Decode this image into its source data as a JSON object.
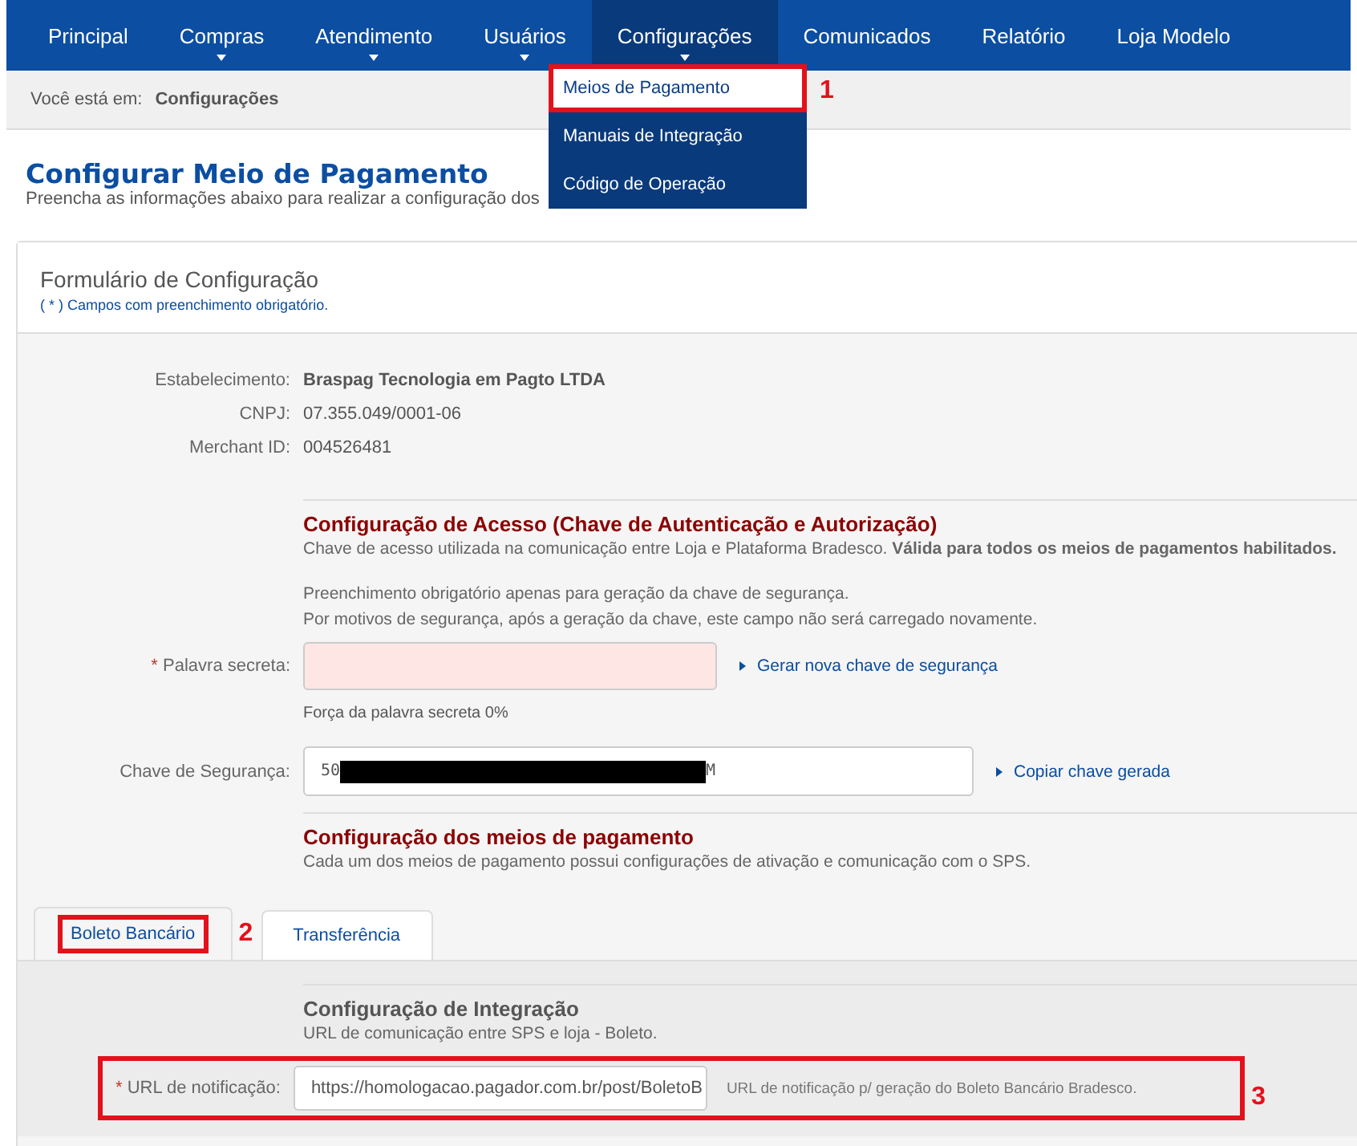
{
  "nav": {
    "items": [
      {
        "label": "Principal",
        "selected": false,
        "has_submenu": false
      },
      {
        "label": "Compras",
        "selected": false,
        "has_submenu": true
      },
      {
        "label": "Atendimento",
        "selected": false,
        "has_submenu": true
      },
      {
        "label": "Usuários",
        "selected": false,
        "has_submenu": true
      },
      {
        "label": "Configurações",
        "selected": true,
        "has_submenu": true
      },
      {
        "label": "Comunicados",
        "selected": false,
        "has_submenu": false
      },
      {
        "label": "Relatório",
        "selected": false,
        "has_submenu": false
      },
      {
        "label": "Loja Modelo",
        "selected": false,
        "has_submenu": false
      }
    ],
    "dropdown": [
      {
        "label": "Meios de Pagamento",
        "selected": true,
        "annotation": "1"
      },
      {
        "label": "Manuais de Integração",
        "selected": false
      },
      {
        "label": "Código de Operação",
        "selected": false
      }
    ]
  },
  "breadcrumb": {
    "label": "Você está em:",
    "current": "Configurações"
  },
  "page": {
    "title": "Configurar Meio de Pagamento",
    "subtitle": "Preencha as informações abaixo para realizar a configuração dos"
  },
  "panel": {
    "title": "Formulário de Configuração",
    "note": "( * ) Campos com preenchimento obrigatório.",
    "info": [
      {
        "label": "Estabelecimento:",
        "value": "Braspag Tecnologia em Pagto LTDA",
        "bold": true
      },
      {
        "label": "CNPJ:",
        "value": "07.355.049/0001-06",
        "bold": false
      },
      {
        "label": "Merchant ID:",
        "value": "004526481",
        "bold": false
      }
    ],
    "access": {
      "title": "Configuração de Acesso (Chave de Autenticação e Autorização)",
      "description": "Chave de acesso utilizada na comunicação entre Loja e Plataforma Bradesco. **Válida para todos os meios de pagamentos habilitados.**",
      "notes": [
        "Preenchimento obrigatório apenas para geração da chave de segurança.",
        "Por motivos de segurança, após a geração da chave, este campo não será carregado novamente."
      ]
    },
    "secret": {
      "label": "Palavra secreta:",
      "required_mark": "*",
      "invalid": true,
      "action": "Gerar nova chave de segurança",
      "strength": "Força da palavra secreta 0%"
    },
    "key": {
      "label": "Chave de Segurança:",
      "value_start": "50",
      "value_end": "M",
      "redacted": true,
      "action": "Copiar chave gerada"
    },
    "methods": {
      "title": "Configuração dos meios de pagamento",
      "description": "Cada um dos meios de pagamento possui configurações de ativação e comunicação com o SPS."
    },
    "tabs": [
      {
        "label": "Boleto Bancário",
        "selected": true,
        "annotation": "2"
      },
      {
        "label": "Transferência",
        "selected": false
      }
    ],
    "integration": {
      "title": "Configuração de Integração",
      "description": "URL de comunicação entre SPS e loja - Boleto.",
      "url": {
        "label": "URL de notificação:",
        "required_mark": "*",
        "value": "https://homologacao.pagador.com.br/post/BoletoB",
        "hint": "URL de notificação p/ geração do Boleto Bancário Bradesco.",
        "annotation": "3"
      }
    }
  }
}
